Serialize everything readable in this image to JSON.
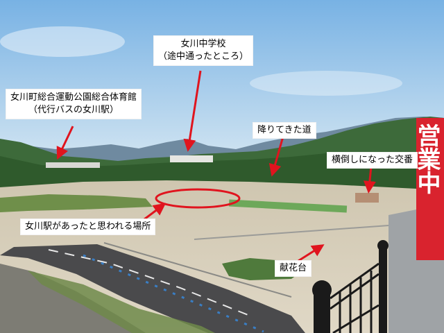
{
  "annotations": {
    "school": {
      "line1": "女川中学校",
      "line2": "（途中通ったところ）"
    },
    "gym": {
      "line1": "女川町総合運動公園総合体育館",
      "line2": "（代行バスの女川駅）"
    },
    "road": "降りてきた道",
    "koban": "横倒しになった交番",
    "station": "女川駅があったと思われる場所",
    "altar": "献花台"
  },
  "banner": {
    "text": "営業中"
  },
  "colors": {
    "annotation": "#e0141e",
    "banner": "#d9232e",
    "sky": "#9cc6ea"
  }
}
